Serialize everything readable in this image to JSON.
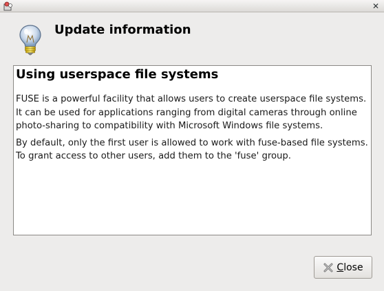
{
  "window": {
    "close_glyph": "✕"
  },
  "header": {
    "title": "Update information",
    "icon": "lightbulb-icon"
  },
  "content": {
    "heading": "Using userspace file systems",
    "paragraphs": [
      "FUSE is a powerful facility that allows users to create userspace file systems. It can be used for applications ranging from digital cameras through online photo-sharing to compatibility with Microsoft Windows file systems.",
      "By default, only the first user is allowed to work with fuse-based file systems. To grant access to other users, add them to the 'fuse' group."
    ]
  },
  "actions": {
    "close_mnemonic": "C",
    "close_rest": "lose",
    "close_icon": "close-icon"
  }
}
